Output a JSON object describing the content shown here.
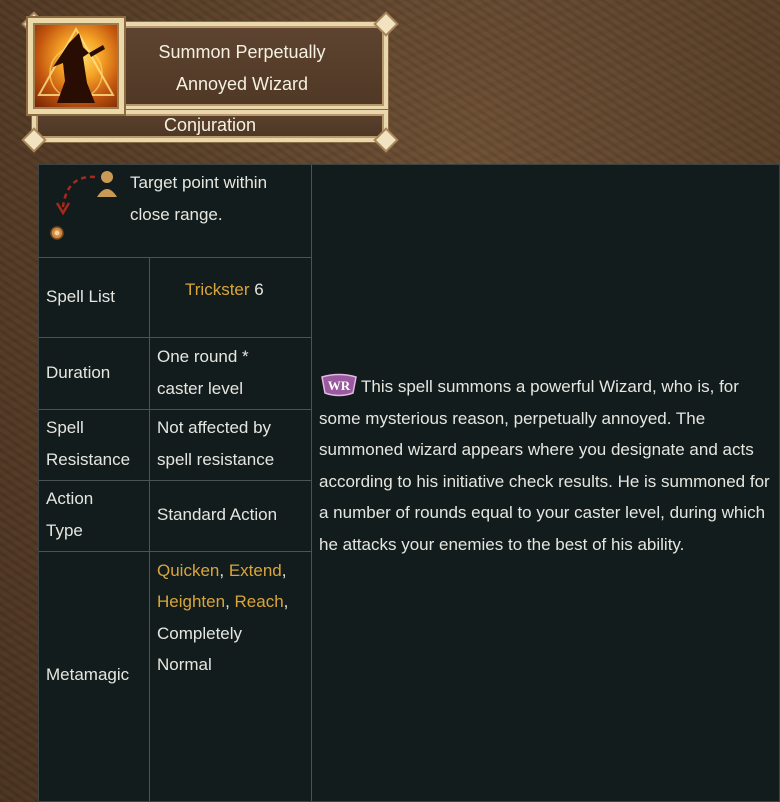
{
  "spell": {
    "title_line1": "Summon Perpetually",
    "title_line2": "Annoyed Wizard",
    "school": "Conjuration",
    "icon": "wizard-spell-icon"
  },
  "target": {
    "icon": "target-point-icon",
    "text_line1": "Target point within",
    "text_line2": "close range."
  },
  "rows": {
    "spell_list": {
      "label": "Spell List",
      "value_link": "Trickster",
      "value_level": " 6"
    },
    "duration": {
      "label": "Duration",
      "value_line1": "One round *",
      "value_line2": "caster level"
    },
    "spell_resistance": {
      "label_line1": "Spell",
      "label_line2": "Resistance",
      "value_line1": "Not affected by",
      "value_line2": "spell resistance"
    },
    "action_type": {
      "label_line1": "Action",
      "label_line2": "Type",
      "value": "Standard Action"
    },
    "metamagic": {
      "label": "Metamagic",
      "links": [
        "Quicken",
        "Extend",
        "Heighten",
        "Reach"
      ],
      "sep": ", ",
      "trail": ",",
      "plain_line1": "Completely",
      "plain_line2": "Normal"
    }
  },
  "description": {
    "badge_text": "WR",
    "text": "This spell summons a powerful Wizard, who is, for some mysterious reason, perpetually annoyed. The summoned wizard appears where you designate and acts according to his initiative check results. He is summoned for a number of rounds equal to your caster level, during which he attacks your enemies to the best of his ability."
  },
  "colors": {
    "link": "#d9a53b",
    "table_bg": "#131c1c",
    "text": "#e6e6e0",
    "plaque_border": "#e9d7ad"
  }
}
